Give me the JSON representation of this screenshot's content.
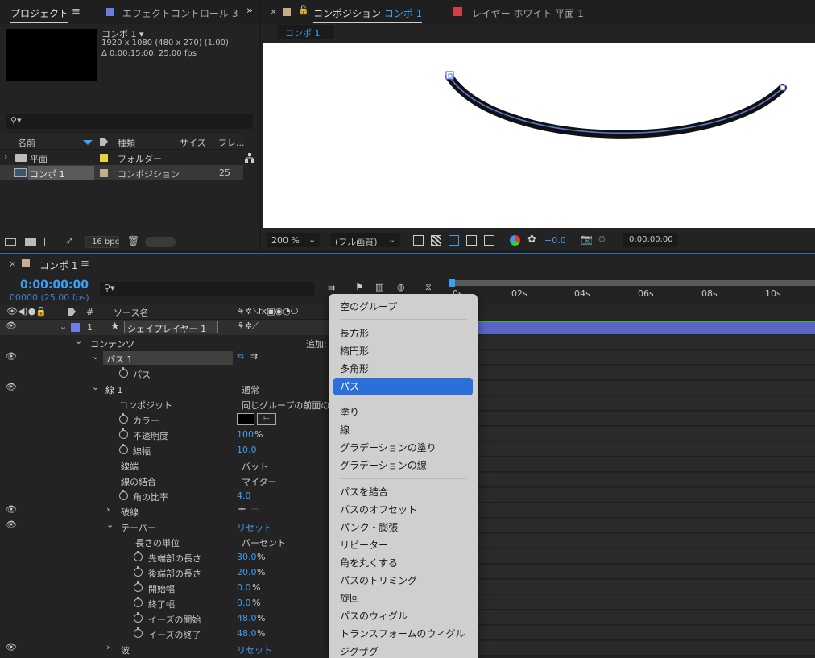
{
  "project_panel": {
    "tab_project": "プロジェクト",
    "tab_effects": "エフェクトコントロール 3",
    "comp_name": "コンポ 1 ▾",
    "comp_res": "1920 x 1080 (480 x 270) (1.00)",
    "comp_duration": "Δ 0:00:15:00, 25.00 fps",
    "search_placeholder": "",
    "columns": {
      "name": "名前",
      "type": "種類",
      "size": "サイズ",
      "frame": "フレ..."
    },
    "items": [
      {
        "name": "平面",
        "type": "フォルダー",
        "size": "",
        "color": "#e8d23a"
      },
      {
        "name": "コンポ 1",
        "type": "コンポジション",
        "size": "25",
        "color": "#c7ad8a"
      }
    ],
    "bpc": "16 bpc"
  },
  "viewer": {
    "tab_comp_prefix": "コンポジション",
    "tab_comp_name": "コンポ 1",
    "tab_layer": "レイヤー ホワイト 平面 1",
    "breadcrumb": "コンポ 1",
    "zoom": "200 %",
    "quality": "(フル画質)",
    "exposure": "+0.0",
    "timecode": "0:00:00:00"
  },
  "timeline": {
    "tab_name": "コンポ 1",
    "timecode": "0:00:00:00",
    "fps": "00000 (25.00 fps)",
    "col_source": "ソース名",
    "col_num": "#",
    "ruler": [
      "0s",
      "02s",
      "04s",
      "06s",
      "08s",
      "10s"
    ],
    "layer_num": "1",
    "layer_name": "シェイプレイヤー 1",
    "contents": "コンテンツ",
    "add_label": "追加:",
    "props": {
      "path1": "パス 1",
      "path": "パス",
      "stroke1": "線 1",
      "stroke_mode": "通常",
      "composite": "コンポジット",
      "composite_val": "同じグループの前面の",
      "color": "カラー",
      "opacity": "不透明度",
      "opacity_val": "100",
      "width": "線幅",
      "width_val": "10.0",
      "cap": "線端",
      "cap_val": "バット",
      "join": "線の結合",
      "join_val": "マイター",
      "miter": "角の比率",
      "miter_val": "4.0",
      "dash": "破線",
      "taper": "テーパー",
      "taper_reset": "リセット",
      "len_unit": "長さの単位",
      "len_unit_val": "パーセント",
      "start_len": "先端部の長さ",
      "start_len_val": "30.0",
      "end_len": "後端部の長さ",
      "end_len_val": "20.0",
      "start_w": "開始幅",
      "start_w_val": "0.0",
      "end_w": "終了幅",
      "end_w_val": "0.0",
      "ease_in": "イーズの開始",
      "ease_in_val": "48.0",
      "ease_out": "イーズの終了",
      "ease_out_val": "48.0",
      "wave": "波",
      "wave_reset": "リセット",
      "pct": "%"
    }
  },
  "add_menu": {
    "items": [
      "空のグループ",
      "長方形",
      "楕円形",
      "多角形",
      "パス",
      "塗り",
      "線",
      "グラデーションの塗り",
      "グラデーションの線",
      "パスを結合",
      "パスのオフセット",
      "パンク・膨張",
      "リピーター",
      "角を丸くする",
      "パスのトリミング",
      "旋回",
      "パスのウィグル",
      "トランスフォームのウィグル",
      "ジグザグ"
    ],
    "selected": "パス"
  },
  "colors": {
    "accent": "#3d9ff2",
    "layer_label": "#6a7de0",
    "selected_menu": "#2b6fd9"
  }
}
